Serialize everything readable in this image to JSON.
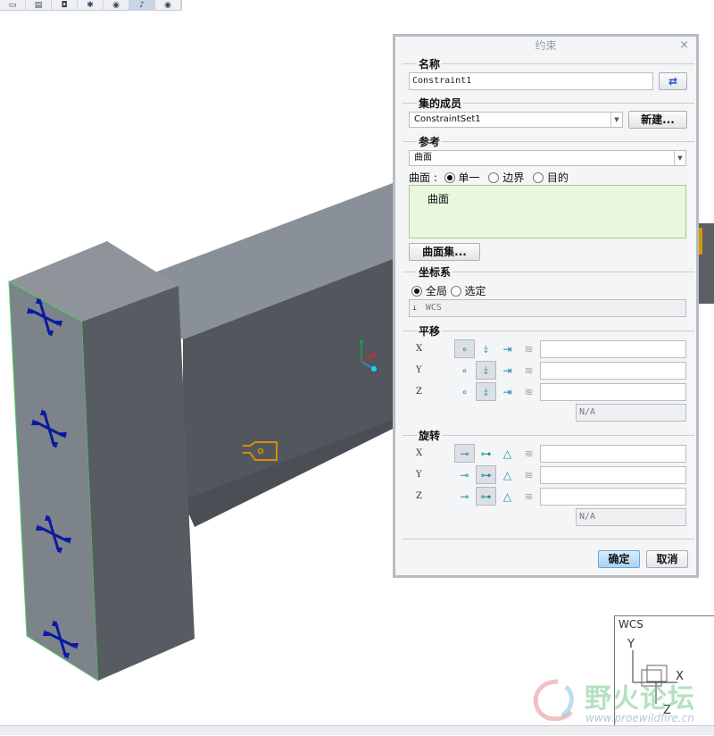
{
  "toolbar": {
    "icons": [
      "view-icon",
      "page-icon",
      "camera-icon",
      "spin-icon",
      "eye-icon",
      "marker-icon",
      "eye-toggle-icon"
    ]
  },
  "dialog": {
    "title": "约束",
    "close": "×",
    "name_group": {
      "label": "名称",
      "value": "Constraint1"
    },
    "set_group": {
      "label": "集的成员",
      "value": "ConstraintSet1",
      "new_button": "新建..."
    },
    "ref_group": {
      "label": "参考",
      "type_value": "曲面",
      "prefix": "曲面 :",
      "options": [
        "单一",
        "边界",
        "目的"
      ],
      "selected_option": 0,
      "list_items": [
        "曲面"
      ],
      "surface_set_button": "曲面集..."
    },
    "cs_group": {
      "label": "坐标系",
      "options": [
        "全局",
        "选定"
      ],
      "selected_option": 0,
      "field": "WCS"
    },
    "translation_group": {
      "label": "平移",
      "rows": [
        "X",
        "Y",
        "Z"
      ],
      "na": "N/A"
    },
    "rotation_group": {
      "label": "旋转",
      "rows": [
        "X",
        "Y",
        "Z"
      ],
      "na": "N/A"
    },
    "ok_button": "确定",
    "cancel_button": "取消"
  },
  "wcs": {
    "label": "WCS",
    "y": "Y",
    "x": "X",
    "z": "Z"
  },
  "watermark": {
    "text": "野火论坛",
    "url": "www.proewildfire.cn"
  },
  "colors": {
    "accent": "#6fa6d2",
    "model": "#5b6066",
    "constraint": "#0a1aa0",
    "load": "#e08a00"
  }
}
